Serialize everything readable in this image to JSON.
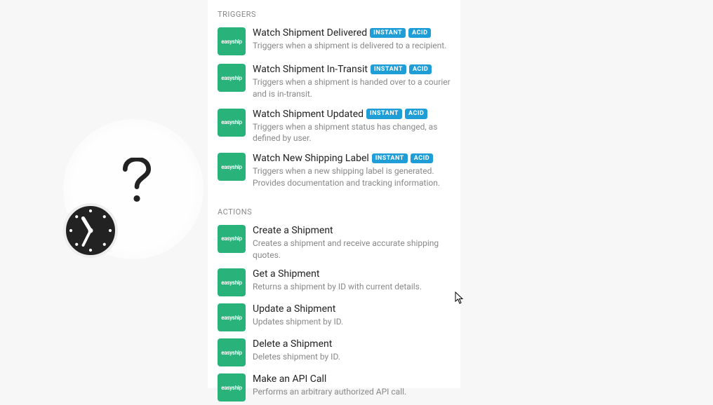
{
  "icon_label": "easyship",
  "badge_instant": "INSTANT",
  "badge_acid": "ACID",
  "triggers": {
    "header": "TRIGGERS",
    "items": [
      {
        "title": "Watch Shipment Delivered",
        "desc": "Triggers when a shipment is delivered to a recipient.",
        "instant": true,
        "acid": true
      },
      {
        "title": "Watch Shipment In-Transit",
        "desc": "Triggers when a shipment is handed over to a courier and is in-transit.",
        "instant": true,
        "acid": true
      },
      {
        "title": "Watch Shipment Updated",
        "desc": "Triggers when a shipment status has changed, as defined by user.",
        "instant": true,
        "acid": true
      },
      {
        "title": "Watch New Shipping Label",
        "desc": "Triggers when a new shipping label is generated. Provides documentation and tracking information.",
        "instant": true,
        "acid": true
      }
    ]
  },
  "actions": {
    "header": "ACTIONS",
    "items": [
      {
        "title": "Create a Shipment",
        "desc": "Creates a shipment and receive accurate shipping quotes."
      },
      {
        "title": "Get a Shipment",
        "desc": "Returns a shipment by ID with current details."
      },
      {
        "title": "Update a Shipment",
        "desc": "Updates shipment by ID."
      },
      {
        "title": "Delete a Shipment",
        "desc": "Deletes shipment by ID."
      },
      {
        "title": "Make an API Call",
        "desc": "Performs an arbitrary authorized API call."
      }
    ]
  }
}
